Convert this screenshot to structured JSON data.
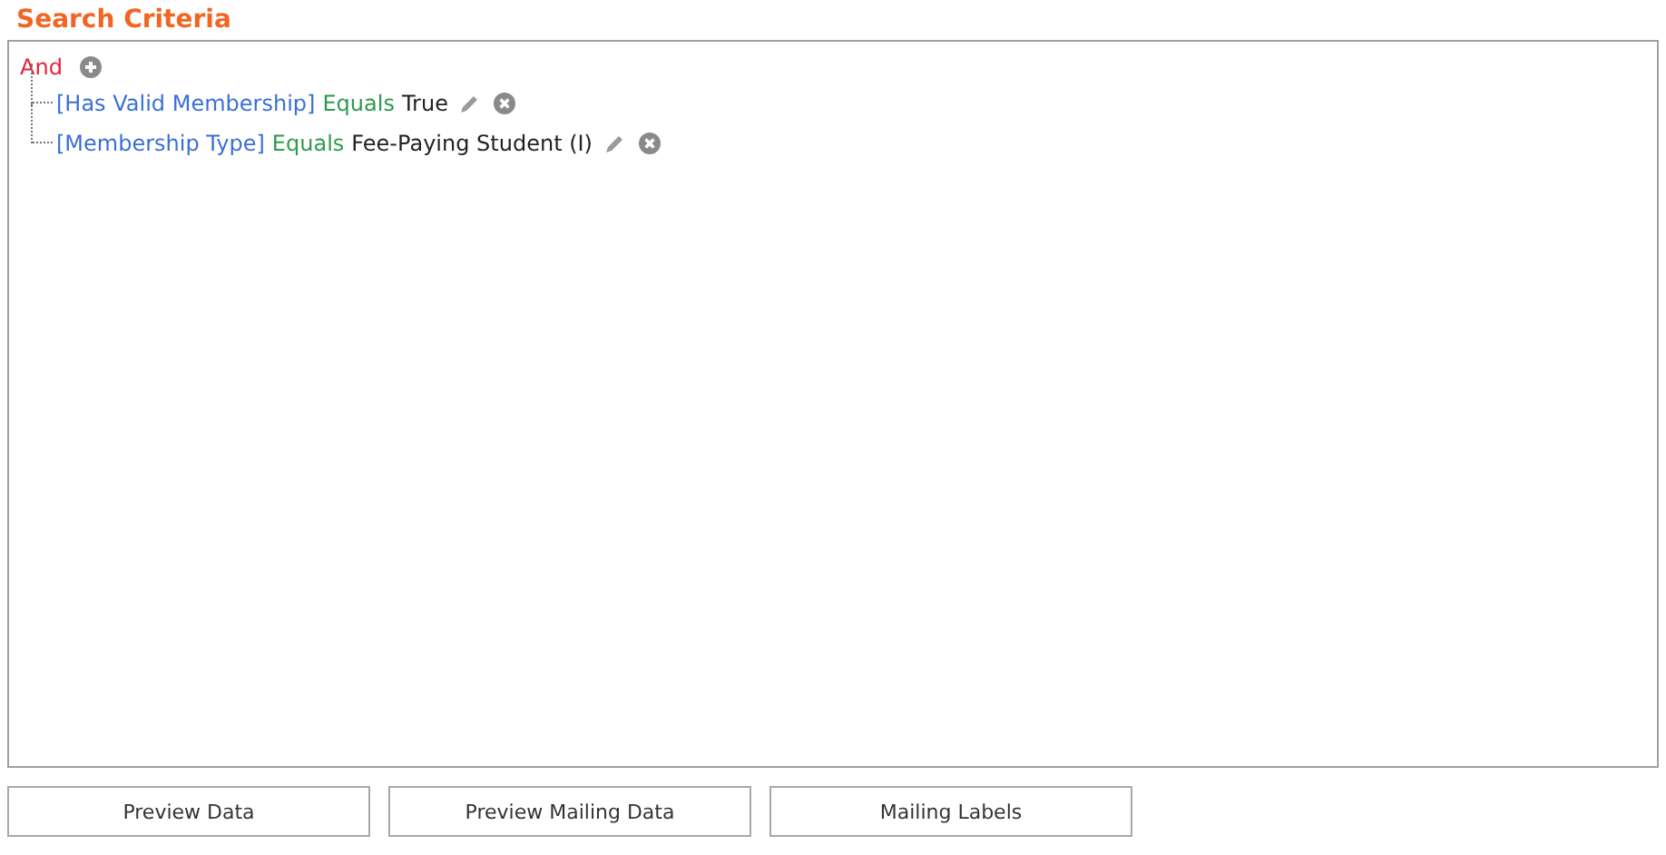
{
  "title": "Search Criteria",
  "group": {
    "operator": "And",
    "conditions": [
      {
        "field": "[Has Valid Membership]",
        "comparison": "Equals",
        "value": "True"
      },
      {
        "field": "[Membership Type]",
        "comparison": "Equals",
        "value": "Fee-Paying Student (I)"
      }
    ]
  },
  "buttons": [
    "Preview Data",
    "Preview Mailing Data",
    "Mailing Labels"
  ]
}
